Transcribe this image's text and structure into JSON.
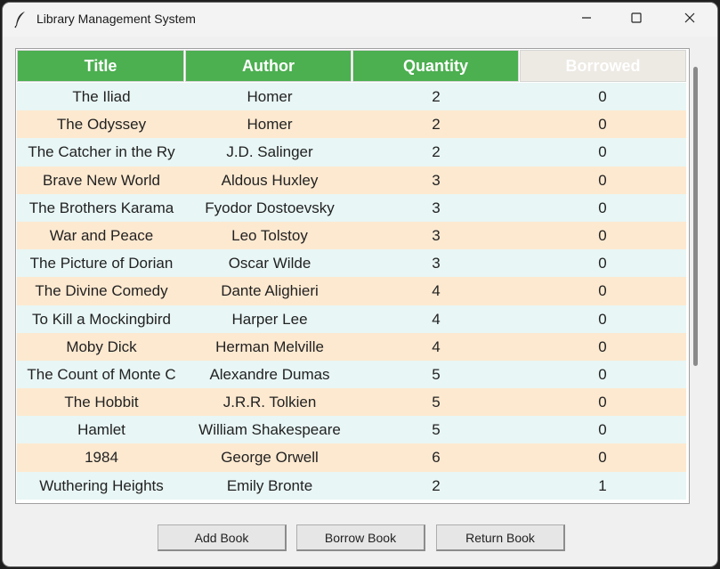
{
  "window": {
    "title": "Library Management System"
  },
  "table": {
    "columns": [
      "Title",
      "Author",
      "Quantity",
      "Borrowed"
    ],
    "rows": [
      [
        "The Iliad",
        "Homer",
        "2",
        "0"
      ],
      [
        "The Odyssey",
        "Homer",
        "2",
        "0"
      ],
      [
        "The Catcher in the Ry",
        "J.D. Salinger",
        "2",
        "0"
      ],
      [
        "Brave New World",
        "Aldous Huxley",
        "3",
        "0"
      ],
      [
        "The Brothers Karama",
        "Fyodor Dostoevsky",
        "3",
        "0"
      ],
      [
        "War and Peace",
        "Leo Tolstoy",
        "3",
        "0"
      ],
      [
        "The Picture of Dorian",
        "Oscar Wilde",
        "3",
        "0"
      ],
      [
        "The Divine Comedy",
        "Dante Alighieri",
        "4",
        "0"
      ],
      [
        "To Kill a Mockingbird",
        "Harper Lee",
        "4",
        "0"
      ],
      [
        "Moby Dick",
        "Herman Melville",
        "4",
        "0"
      ],
      [
        "The Count of Monte C",
        "Alexandre Dumas",
        "5",
        "0"
      ],
      [
        "The Hobbit",
        "J.R.R. Tolkien",
        "5",
        "0"
      ],
      [
        "Hamlet",
        "William Shakespeare",
        "5",
        "0"
      ],
      [
        "1984",
        "George Orwell",
        "6",
        "0"
      ],
      [
        "Wuthering Heights",
        "Emily Bronte",
        "2",
        "1"
      ]
    ],
    "colors": {
      "header_active": "#4caf50",
      "header_inactive": "#ede9e3",
      "row_even": "#e8f6f5",
      "row_odd": "#fde9d0"
    }
  },
  "buttons": {
    "add": "Add Book",
    "borrow": "Borrow Book",
    "return": "Return Book"
  },
  "icons": {
    "app": "feather-icon",
    "minimize": "minimize-icon",
    "maximize": "maximize-icon",
    "close": "close-icon"
  }
}
